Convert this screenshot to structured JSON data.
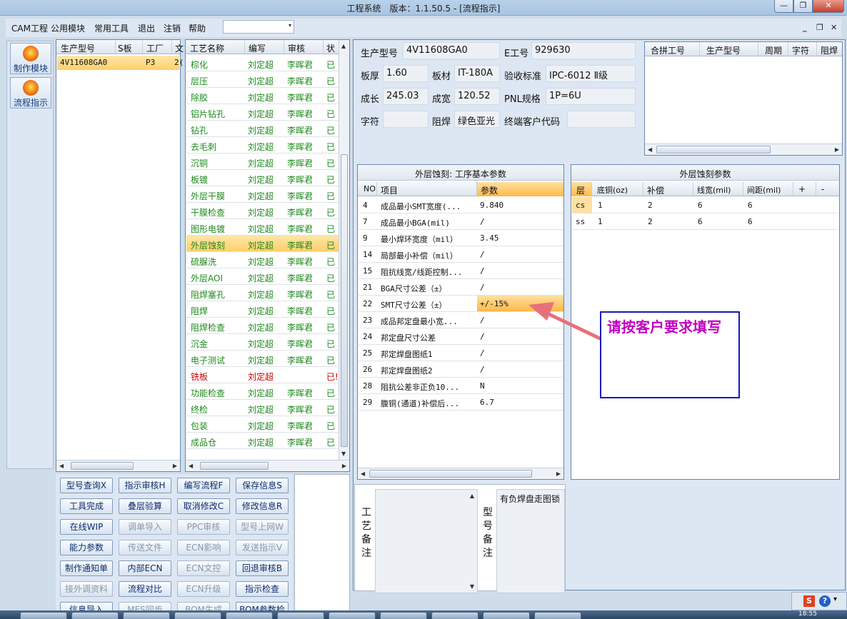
{
  "window": {
    "title": "工程系统　版本：1.1.50.5 - [流程指示]",
    "min": "—",
    "max": "❐",
    "close": "✕"
  },
  "menu": {
    "items": [
      "CAM工程",
      "公用模块",
      "常用工具",
      "退出",
      "注销",
      "帮助"
    ],
    "combo_arrow": "▾",
    "mdi_min": "_",
    "mdi_restore": "❐",
    "mdi_close": "✕"
  },
  "lefttool": {
    "make_module": "制作模块",
    "flow_guide": "流程指示"
  },
  "model_grid": {
    "headers": [
      "生产型号",
      "S板",
      "工厂",
      "文"
    ],
    "row": [
      "4V11608GA0",
      "P3",
      "2("
    ]
  },
  "process_grid": {
    "headers": [
      "工艺名称",
      "编写",
      "审核",
      "状"
    ],
    "rows": [
      [
        "棕化",
        "刘定超",
        "李晖君",
        "已"
      ],
      [
        "层压",
        "刘定超",
        "李晖君",
        "已"
      ],
      [
        "除胶",
        "刘定超",
        "李晖君",
        "已"
      ],
      [
        "铝片钻孔",
        "刘定超",
        "李晖君",
        "已"
      ],
      [
        "钻孔",
        "刘定超",
        "李晖君",
        "已"
      ],
      [
        "去毛刺",
        "刘定超",
        "李晖君",
        "已"
      ],
      [
        "沉铜",
        "刘定超",
        "李晖君",
        "已"
      ],
      [
        "板镀",
        "刘定超",
        "李晖君",
        "已"
      ],
      [
        "外层干膜",
        "刘定超",
        "李晖君",
        "已"
      ],
      [
        "干膜检查",
        "刘定超",
        "李晖君",
        "已"
      ],
      [
        "图形电镀",
        "刘定超",
        "李晖君",
        "已"
      ],
      [
        "外层蚀刻",
        "刘定超",
        "李晖君",
        "已"
      ],
      [
        "硫脲洗",
        "刘定超",
        "李晖君",
        "已"
      ],
      [
        "外层AOI",
        "刘定超",
        "李晖君",
        "已"
      ],
      [
        "阻焊塞孔",
        "刘定超",
        "李晖君",
        "已"
      ],
      [
        "阻焊",
        "刘定超",
        "李晖君",
        "已"
      ],
      [
        "阻焊检查",
        "刘定超",
        "李晖君",
        "已"
      ],
      [
        "沉金",
        "刘定超",
        "李晖君",
        "已"
      ],
      [
        "电子测试",
        "刘定超",
        "李晖君",
        "已"
      ],
      [
        "铣板",
        "刘定超",
        "",
        "已!"
      ],
      [
        "功能检查",
        "刘定超",
        "李晖君",
        "已"
      ],
      [
        "终检",
        "刘定超",
        "李晖君",
        "已"
      ],
      [
        "包装",
        "刘定超",
        "李晖君",
        "已"
      ],
      [
        "成品仓",
        "刘定超",
        "李晖君",
        "已"
      ]
    ]
  },
  "buttons": [
    [
      "型号查询X",
      "指示审核H",
      "编写流程F",
      "保存信息S"
    ],
    [
      "工具完成",
      "叠层验算",
      "取消修改C",
      "修改信息R"
    ],
    [
      "在线WIP",
      "调单导入",
      "PPC审核",
      "型号上网W"
    ],
    [
      "能力参数",
      "传送文件",
      "ECN影响",
      "发送指示V"
    ],
    [
      "制作通知单",
      "内部ECN",
      "ECN文控",
      "回退审核B"
    ],
    [
      "接外调资料",
      "流程对比",
      "ECN升级",
      "指示检查"
    ],
    [
      "信息导入",
      "MES同步",
      "BOM生成",
      "BOM参数检查"
    ]
  ],
  "info": {
    "model_label": "生产型号",
    "model": "4V11608GA0",
    "eno_label": "E工号",
    "eno": "929630",
    "thick_label": "板厚",
    "thick": "1.60",
    "material_label": "板材",
    "material": "IT-180A",
    "std_label": "验收标准",
    "std": "IPC-6012 Ⅱ级",
    "len_label": "成长",
    "len": "245.03",
    "width_label": "成宽",
    "width": "120.52",
    "pnl_label": "PNL规格",
    "pnl": "1P=6U",
    "char_label": "字符",
    "char": "",
    "mask_label": "阻焊",
    "mask": "绿色亚光",
    "cust_label": "终端客户代码",
    "cust": ""
  },
  "merge_grid": {
    "headers": [
      "合拼工号",
      "生产型号",
      "周期",
      "字符",
      "阻焊"
    ]
  },
  "param_grid": {
    "title": "外层蚀刻: 工序基本参数",
    "headers": [
      "NO",
      "项目",
      "参数"
    ],
    "rows": [
      [
        "4",
        "成品最小SMT宽度(...",
        "9.840"
      ],
      [
        "7",
        "成品最小BGA(mil)",
        "/"
      ],
      [
        "9",
        "最小焊环宽度（mil）",
        "3.45"
      ],
      [
        "14",
        "局部最小补偿（mil）",
        "/"
      ],
      [
        "15",
        "阻抗线宽/线距控制...",
        "/"
      ],
      [
        "21",
        "BGA尺寸公差（±）",
        "/"
      ],
      [
        "22",
        "SMT尺寸公差（±）",
        "+/-15%"
      ],
      [
        "23",
        "成品邦定盘最小宽...",
        "/"
      ],
      [
        "24",
        "邦定盘尺寸公差",
        "/"
      ],
      [
        "25",
        "邦定焊盘图纸1",
        "/"
      ],
      [
        "26",
        "邦定焊盘图纸2",
        "/"
      ],
      [
        "28",
        "阻抗公差非正负10...",
        "N"
      ],
      [
        "29",
        "腹铜(通道)补偿后...",
        "6.7"
      ]
    ]
  },
  "etch_grid": {
    "title": "外层蚀刻参数",
    "headers": [
      "层",
      "底铜(oz)",
      "补偿",
      "线宽(mil)",
      "间距(mil)",
      "+",
      "-"
    ],
    "rows": [
      [
        "cs",
        "1",
        "2",
        "6",
        "6"
      ],
      [
        "ss",
        "1",
        "2",
        "6",
        "6"
      ]
    ]
  },
  "notes": {
    "process_label": "工艺备注",
    "model_label": "型号备注",
    "model_note": "有负焊盘走图锁"
  },
  "callout": {
    "text": "请按客户要求填写"
  },
  "tray": {
    "time": "18:55",
    "s_icon": "S",
    "help_icon": "?"
  }
}
